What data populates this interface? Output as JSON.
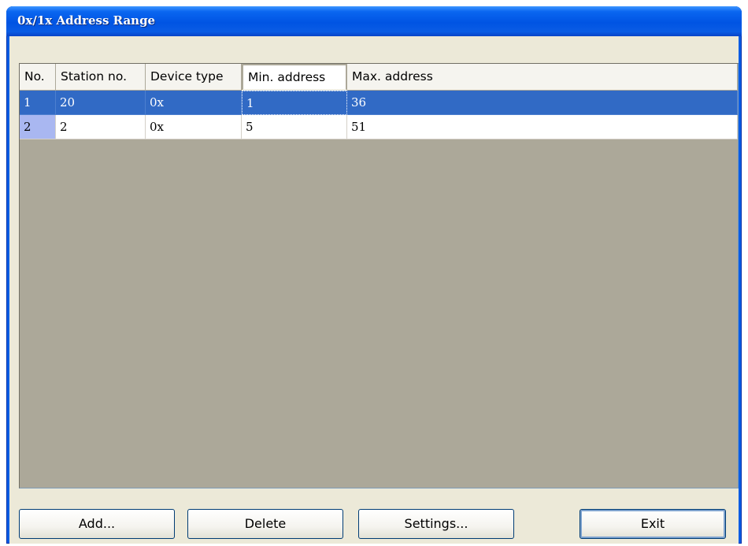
{
  "window": {
    "title": "0x/1x Address Range"
  },
  "table": {
    "columns": [
      "No.",
      "Station no.",
      "Device type",
      "Min. address",
      "Max. address"
    ],
    "rows": [
      [
        "1",
        "20",
        "0x",
        "1",
        "36"
      ],
      [
        "2",
        "2",
        "0x",
        "5",
        "51"
      ]
    ],
    "selected_row": 1
  },
  "buttons": {
    "add": "Add...",
    "delete": "Delete",
    "settings": "Settings...",
    "exit": "Exit"
  },
  "colors": {
    "title_bar": "#0a5ce4",
    "selection": "#316ac5",
    "grid_background": "#aca899",
    "dialog_face": "#ece9d8"
  }
}
